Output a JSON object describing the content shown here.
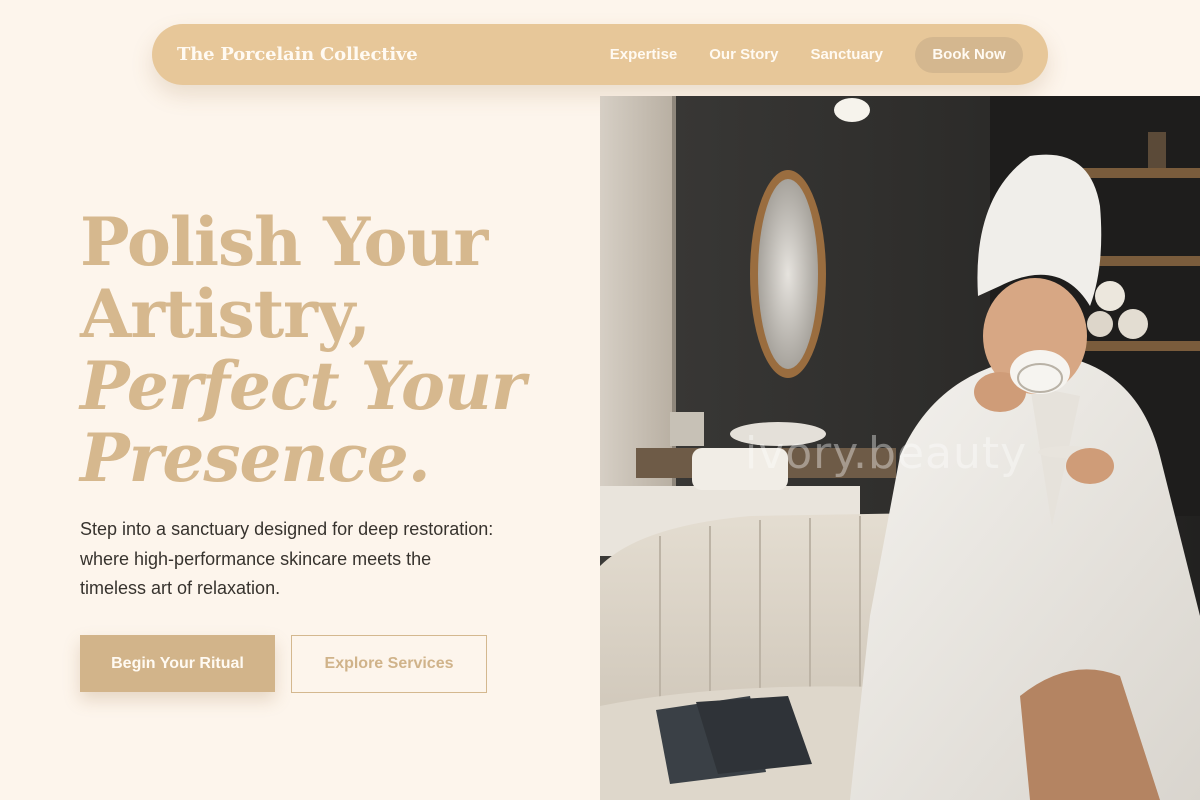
{
  "brand": "The Porcelain Collective",
  "nav": {
    "links": [
      "Expertise",
      "Our Story",
      "Sanctuary"
    ],
    "cta": "Book Now"
  },
  "hero": {
    "title_line1": "Polish Your",
    "title_line2": "Artistry,",
    "title_line3": "Perfect Your",
    "title_line4": "Presence.",
    "description": "Step into a sanctuary designed for deep restoration: where high-performance skincare meets the timeless art of relaxation.",
    "primary_button": "Begin Your Ritual",
    "secondary_button": "Explore Services"
  },
  "image": {
    "watermark": "ivory.beauty"
  },
  "colors": {
    "background": "#fdf5ec",
    "nav": "#e7c799",
    "accent": "#d2b48a",
    "heading": "#d6b88e",
    "body_text": "#37332e"
  }
}
